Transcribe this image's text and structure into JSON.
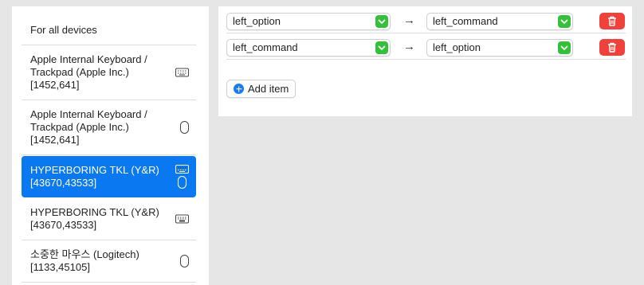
{
  "sidebar": {
    "items": [
      {
        "label": "For all devices",
        "icons": [],
        "selected": false
      },
      {
        "label": "Apple Internal Keyboard /\nTrackpad (Apple Inc.)\n[1452,641]",
        "icons": [
          "keyboard-icon"
        ],
        "selected": false
      },
      {
        "label": "Apple Internal Keyboard /\nTrackpad (Apple Inc.)\n[1452,641]",
        "icons": [
          "mouse-icon"
        ],
        "selected": false
      },
      {
        "label": "HYPERBORING TKL (Y&R)\n[43670,43533]",
        "icons": [
          "keyboard-icon",
          "mouse-icon"
        ],
        "selected": true
      },
      {
        "label": "HYPERBORING TKL (Y&R)\n[43670,43533]",
        "icons": [
          "keyboard-icon"
        ],
        "selected": false
      },
      {
        "label": "소중한 마우스 (Logitech)\n[1133,45105]",
        "icons": [
          "mouse-icon"
        ],
        "selected": false
      }
    ]
  },
  "rules": [
    {
      "from": "left_option",
      "arrow": "→",
      "to": "left_command"
    },
    {
      "from": "left_command",
      "arrow": "→",
      "to": "left_option"
    }
  ],
  "add_item_label": "Add item",
  "colors": {
    "selection": "#0a78f0",
    "select_chevron": "#34c13a",
    "delete_button": "#f0413a",
    "add_icon": "#1a7bf0"
  }
}
